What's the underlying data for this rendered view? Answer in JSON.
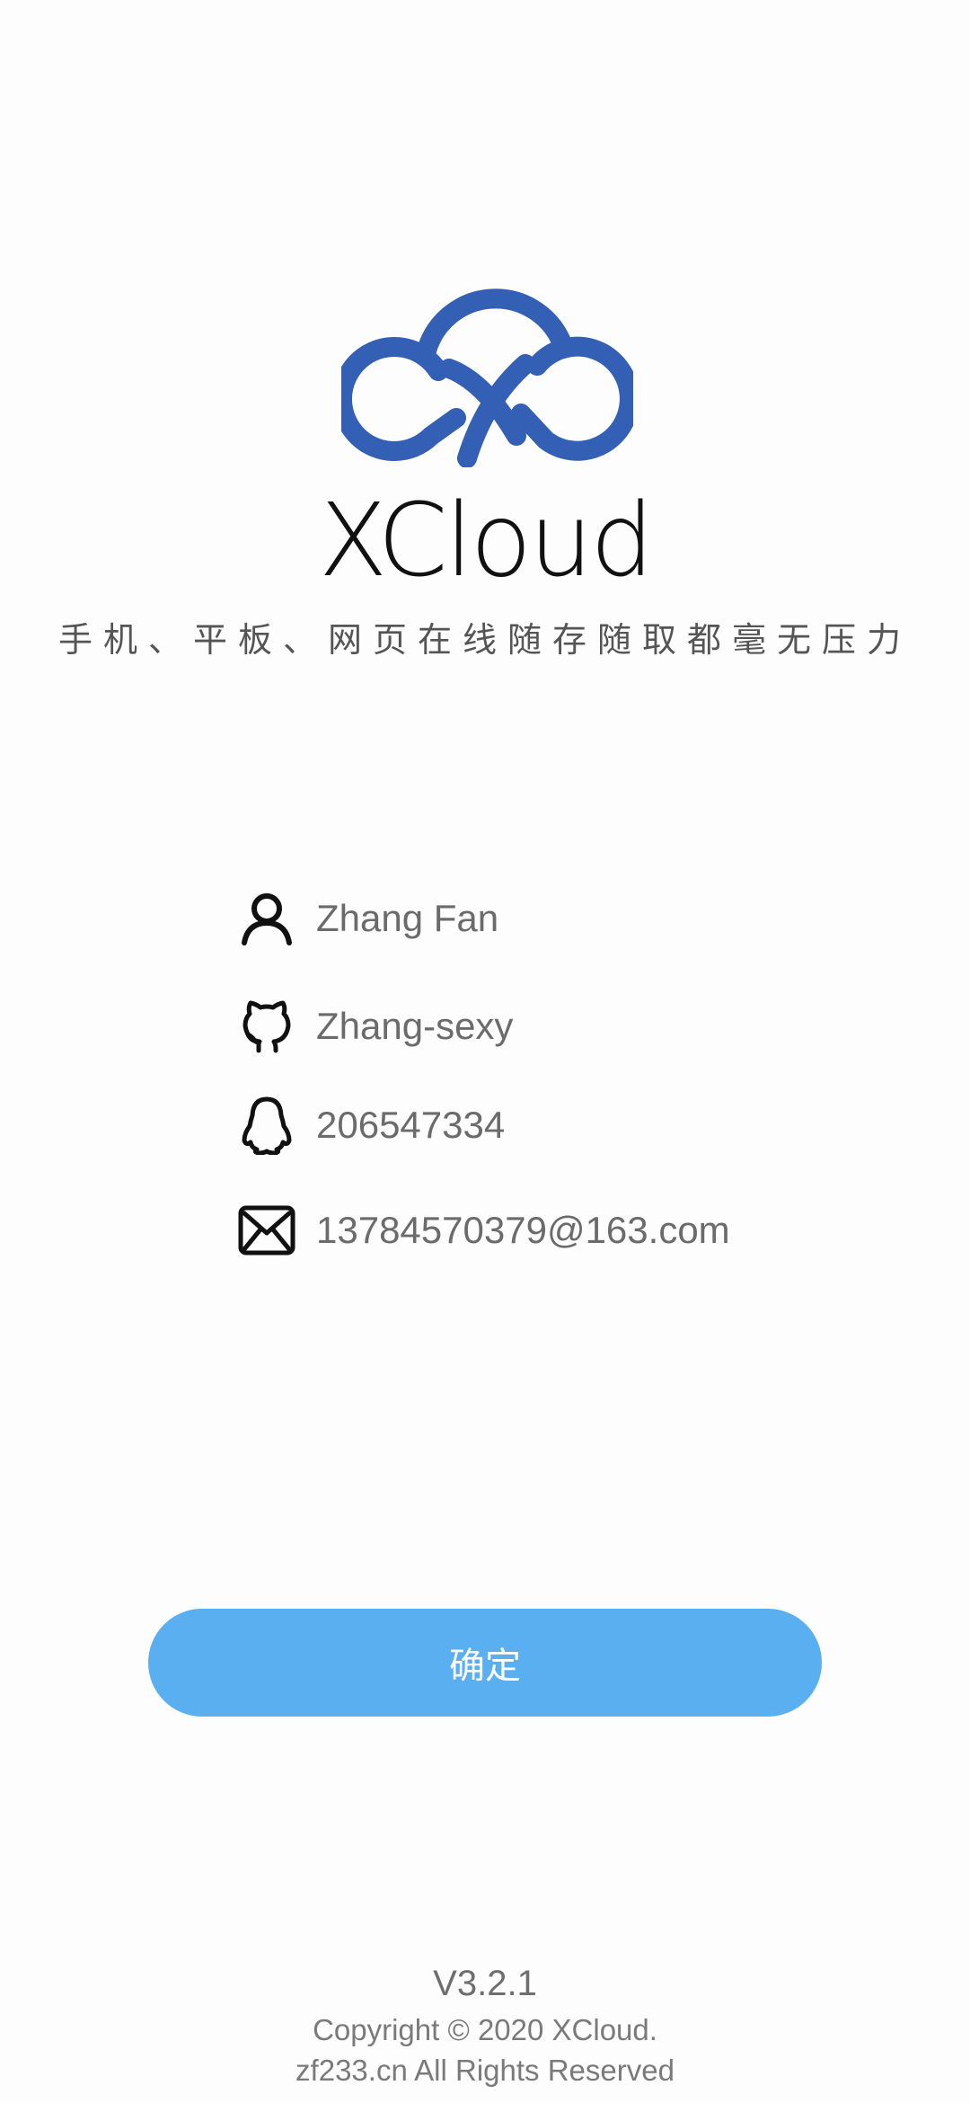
{
  "app": {
    "name": "XCloud",
    "slogan": "手机、平板、网页在线随存随取都毫无压力",
    "brand_color": "#3360b5"
  },
  "info": [
    {
      "icon": "user-icon",
      "text": "Zhang Fan"
    },
    {
      "icon": "github-icon",
      "text": "Zhang-sexy"
    },
    {
      "icon": "qq-icon",
      "text": "206547334"
    },
    {
      "icon": "mail-icon",
      "text": "13784570379@163.com"
    }
  ],
  "confirm_button": {
    "label": "确定",
    "color": "#5aaff0"
  },
  "footer": {
    "version": "V3.2.1",
    "copyright": "Copyright © 2020 XCloud.",
    "rights": "zf233.cn All Rights Reserved"
  }
}
